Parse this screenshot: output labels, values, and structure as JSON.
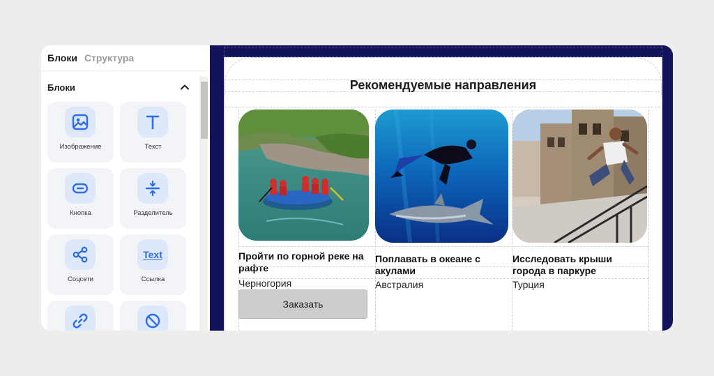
{
  "sidebar": {
    "tabs": [
      {
        "label": "Блоки"
      },
      {
        "label": "Структура"
      }
    ],
    "section_title": "Блоки",
    "blocks": [
      {
        "label": "Изображение",
        "icon": "image-icon"
      },
      {
        "label": "Текст",
        "icon": "text-icon"
      },
      {
        "label": "Кнопка",
        "icon": "button-icon"
      },
      {
        "label": "Разделитель",
        "icon": "divider-icon"
      },
      {
        "label": "Соцсети",
        "icon": "share-icon"
      },
      {
        "label": "Ссылка",
        "icon": "link-text-icon",
        "icon_text": "Text"
      },
      {
        "label": "",
        "icon": "link-icon"
      },
      {
        "label": "",
        "icon": "blocked-icon"
      }
    ]
  },
  "email": {
    "title": "Рекомендуемые направления",
    "cards": [
      {
        "title": "Пройти по горной реке на рафте",
        "place": "Черногория",
        "button": "Заказать"
      },
      {
        "title": "Поплавать в океане с акулами",
        "place": "Австралия"
      },
      {
        "title": "Исследовать крыши города в паркуре",
        "place": "Турция"
      }
    ]
  },
  "colors": {
    "canvas_bg": "#13135a",
    "accent": "#2f6ce5",
    "icon_tile": "#dde8fb",
    "card_bg": "#f3f4f7",
    "button_bg": "#cccccc"
  }
}
